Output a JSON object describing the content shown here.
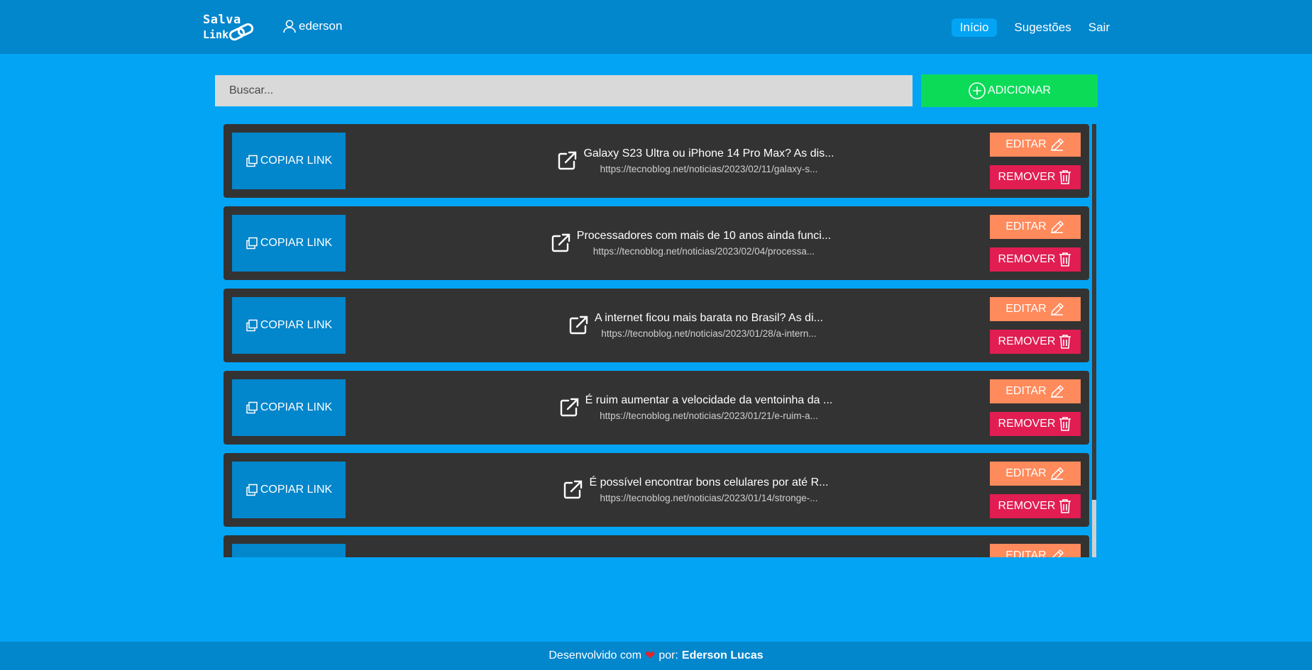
{
  "header": {
    "logo_line1": "Salva",
    "logo_line2": "Link",
    "username": "ederson",
    "nav": [
      {
        "label": "Início"
      },
      {
        "label": "Sugestões"
      },
      {
        "label": "Sair"
      }
    ]
  },
  "toolbar": {
    "search_placeholder": "Buscar...",
    "search_value": "",
    "add_label": "ADICIONAR"
  },
  "links": [
    {
      "title": "Galaxy S23 Ultra ou iPhone 14 Pro Max? As dis...",
      "url": "https://tecnoblog.net/noticias/2023/02/11/galaxy-s..."
    },
    {
      "title": "Processadores com mais de 10 anos ainda funci...",
      "url": "https://tecnoblog.net/noticias/2023/02/04/processa..."
    },
    {
      "title": "A internet ficou mais barata no Brasil? As di...",
      "url": "https://tecnoblog.net/noticias/2023/01/28/a-intern..."
    },
    {
      "title": "É ruim aumentar a velocidade da ventoinha da ...",
      "url": "https://tecnoblog.net/noticias/2023/01/21/e-ruim-a..."
    },
    {
      "title": "É possível encontrar bons celulares por até R...",
      "url": "https://tecnoblog.net/noticias/2023/01/14/stronge-..."
    },
    {
      "title": "",
      "url": ""
    }
  ],
  "card_actions": {
    "copy_label": "COPIAR LINK",
    "edit_label": "EDITAR",
    "remove_label": "REMOVER"
  },
  "footer": {
    "prefix": "Desenvolvido com",
    "middle": "por:",
    "author": "Ederson Lucas"
  },
  "colors": {
    "background": "#03a4f4",
    "navbar": "#0286cc",
    "add": "#0cdb58",
    "card": "#333333",
    "copy": "#0286cc",
    "edit": "#ff8a5c",
    "remove": "#e11d52"
  }
}
